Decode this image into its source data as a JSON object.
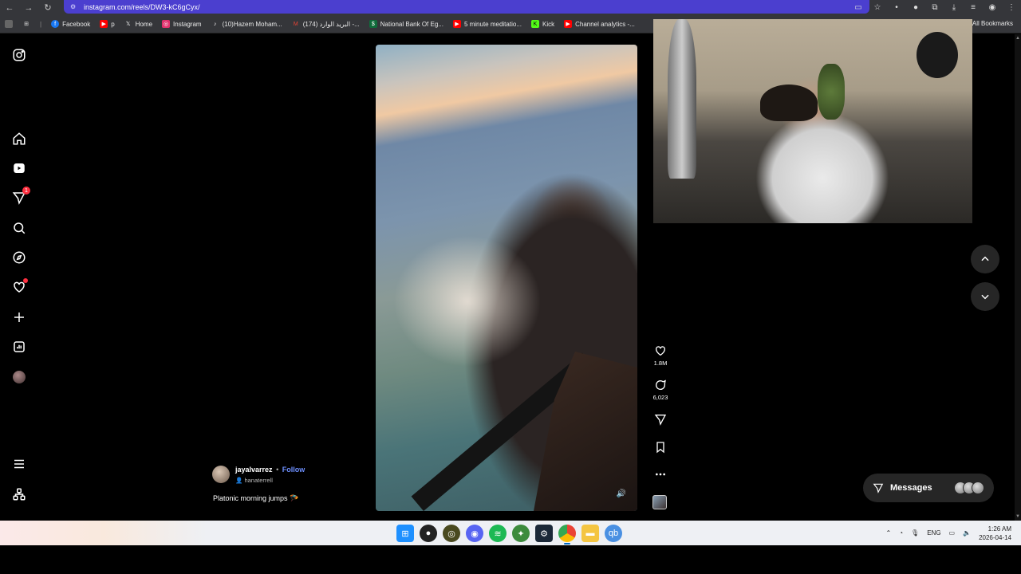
{
  "browser": {
    "url": "instagram.com/reels/DW3-kC6gCyx/",
    "nav": {
      "back_icon": "back-arrow-icon",
      "forward_icon": "forward-arrow-icon",
      "reload_icon": "reload-icon"
    },
    "bookmarks": [
      {
        "label": "Facebook",
        "icon": "facebook-icon",
        "color": "#1877f2"
      },
      {
        "label": "p",
        "icon": "youtube-icon",
        "color": "#ff0000"
      },
      {
        "label": "Home",
        "icon": "x-icon",
        "color": "#000000"
      },
      {
        "label": "Instagram",
        "icon": "instagram-icon",
        "color": "#e1306c"
      },
      {
        "label": "(10)Hazem Moham...",
        "icon": "tiktok-icon",
        "color": "#111111"
      },
      {
        "label": "(174) البريد الوارد -...",
        "icon": "gmail-icon",
        "color": "#ea4335"
      },
      {
        "label": "National Bank Of Eg...",
        "icon": "bank-icon",
        "color": "#0f6b3a"
      },
      {
        "label": "5 minute meditatio...",
        "icon": "youtube-icon",
        "color": "#ff0000"
      },
      {
        "label": "Kick",
        "icon": "kick-icon",
        "color": "#53fc18"
      },
      {
        "label": "Channel analytics -...",
        "icon": "youtube-icon",
        "color": "#ff0000"
      }
    ],
    "all_bookmarks_label": "All Bookmarks"
  },
  "reel": {
    "author": {
      "username": "jayalvarrez",
      "separator": "•",
      "follow_label": "Follow",
      "collaborator": "hanaterrell"
    },
    "caption": "Platonic morning jumps 🪂",
    "actions": {
      "likes": "1.8M",
      "comments": "6,023"
    }
  },
  "messages": {
    "label": "Messages"
  },
  "taskbar": {
    "language": "ENG",
    "time": "1:26 AM",
    "date": "2026-04-14"
  }
}
